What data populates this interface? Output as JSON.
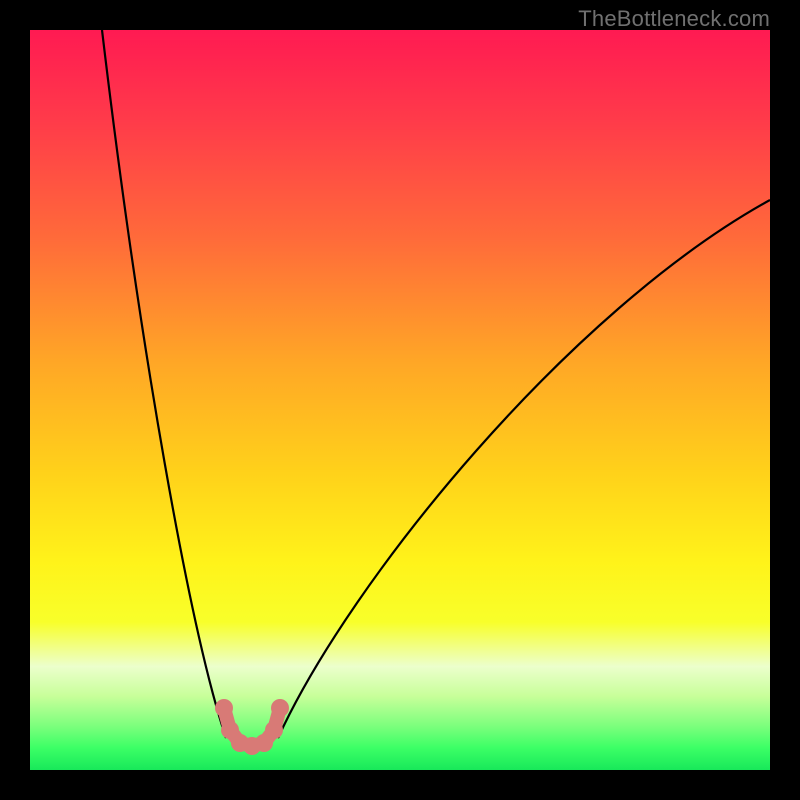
{
  "watermark": "TheBottleneck.com",
  "colors": {
    "black": "#000000",
    "curve_stroke": "#000000",
    "marker_fill": "#d87a76",
    "watermark_text": "#707070",
    "gradient_stops": [
      {
        "offset": 0.0,
        "color": "#ff1a52"
      },
      {
        "offset": 0.12,
        "color": "#ff3a4a"
      },
      {
        "offset": 0.28,
        "color": "#ff6a3a"
      },
      {
        "offset": 0.45,
        "color": "#ffa726"
      },
      {
        "offset": 0.6,
        "color": "#ffd21a"
      },
      {
        "offset": 0.72,
        "color": "#fff31a"
      },
      {
        "offset": 0.8,
        "color": "#f8ff2a"
      },
      {
        "offset": 0.86,
        "color": "#ecffcc"
      },
      {
        "offset": 0.9,
        "color": "#c8ff9a"
      },
      {
        "offset": 0.94,
        "color": "#7dff7d"
      },
      {
        "offset": 0.97,
        "color": "#3cff66"
      },
      {
        "offset": 1.0,
        "color": "#18e85a"
      }
    ]
  },
  "chart_data": {
    "type": "line",
    "title": "",
    "xlabel": "",
    "ylabel": "",
    "x_range": [
      0,
      740
    ],
    "y_range_inverted": [
      0,
      740
    ],
    "series": [
      {
        "name": "left-branch",
        "kind": "cubic-bezier",
        "p0": [
          72,
          0
        ],
        "c1": [
          110,
          320
        ],
        "c2": [
          160,
          600
        ],
        "p1": [
          196,
          708
        ]
      },
      {
        "name": "right-branch",
        "kind": "cubic-bezier",
        "p0": [
          248,
          708
        ],
        "c1": [
          320,
          550
        ],
        "c2": [
          540,
          280
        ],
        "p1": [
          740,
          170
        ]
      }
    ],
    "markers": {
      "kind": "u-shape",
      "points": [
        {
          "x": 194,
          "y": 678
        },
        {
          "x": 200,
          "y": 700
        },
        {
          "x": 210,
          "y": 713
        },
        {
          "x": 222,
          "y": 716
        },
        {
          "x": 234,
          "y": 713
        },
        {
          "x": 244,
          "y": 700
        },
        {
          "x": 250,
          "y": 678
        }
      ]
    }
  }
}
